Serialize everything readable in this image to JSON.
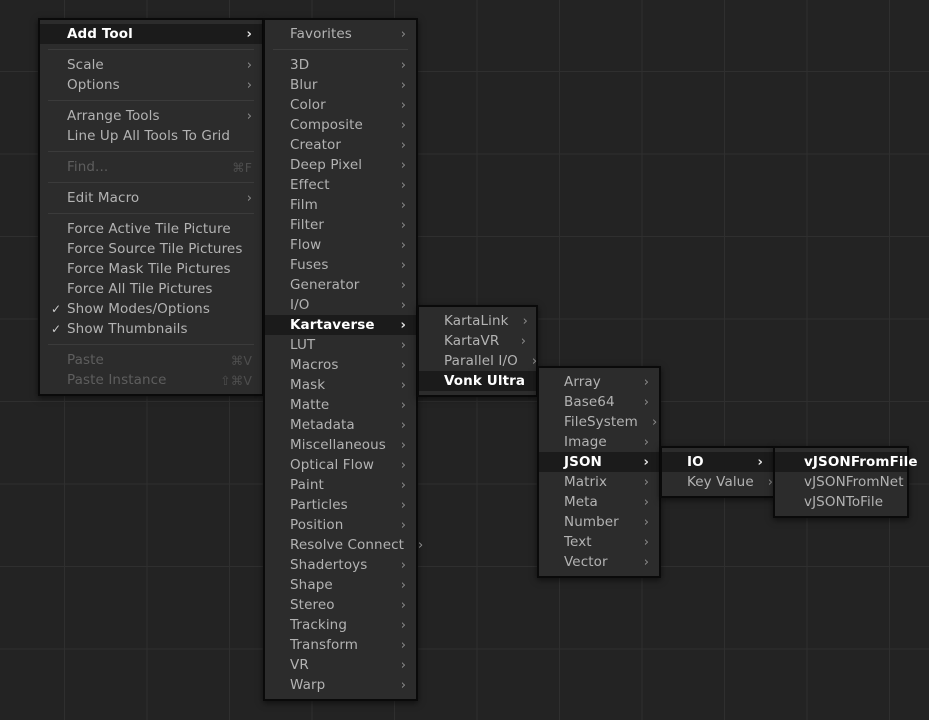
{
  "app": {
    "surface": "fusion-node-editor-canvas",
    "background_color": "#232323",
    "grid_line_color": "#2f2f2f",
    "menu_background": "#2c2c2c",
    "menu_border": "#0a0a0a",
    "menu_text": "#b3b3b3",
    "menu_text_disabled": "#5e5e5e",
    "highlight_background": "#1b1b1b",
    "highlight_text": "#ffffff"
  },
  "icons": {
    "submenu_arrow": "›",
    "checkmark": "✓"
  },
  "menus": {
    "main": {
      "name": "node-editor-context-menu",
      "items": [
        {
          "label": "Add Tool",
          "arrow": true,
          "highlighted": true
        },
        {
          "separator": true
        },
        {
          "label": "Scale",
          "arrow": true
        },
        {
          "label": "Options",
          "arrow": true
        },
        {
          "separator": true
        },
        {
          "label": "Arrange Tools",
          "arrow": true
        },
        {
          "label": "Line Up All Tools To Grid"
        },
        {
          "separator": true
        },
        {
          "label": "Find...",
          "shortcut": "⌘F",
          "disabled": true
        },
        {
          "separator": true
        },
        {
          "label": "Edit Macro",
          "arrow": true
        },
        {
          "separator": true
        },
        {
          "label": "Force Active Tile Picture"
        },
        {
          "label": "Force Source Tile Pictures"
        },
        {
          "label": "Force Mask Tile Pictures"
        },
        {
          "label": "Force All Tile Pictures"
        },
        {
          "label": "Show Modes/Options",
          "checked": true
        },
        {
          "label": "Show Thumbnails",
          "checked": true
        },
        {
          "separator": true
        },
        {
          "label": "Paste",
          "shortcut": "⌘V",
          "disabled": true
        },
        {
          "label": "Paste Instance",
          "shortcut": "⇧⌘V",
          "disabled": true
        }
      ]
    },
    "categories": {
      "name": "add-tool-category-menu",
      "items": [
        {
          "label": "Favorites",
          "arrow": true
        },
        {
          "separator": true
        },
        {
          "label": "3D",
          "arrow": true
        },
        {
          "label": "Blur",
          "arrow": true
        },
        {
          "label": "Color",
          "arrow": true
        },
        {
          "label": "Composite",
          "arrow": true
        },
        {
          "label": "Creator",
          "arrow": true
        },
        {
          "label": "Deep Pixel",
          "arrow": true
        },
        {
          "label": "Effect",
          "arrow": true
        },
        {
          "label": "Film",
          "arrow": true
        },
        {
          "label": "Filter",
          "arrow": true
        },
        {
          "label": "Flow",
          "arrow": true
        },
        {
          "label": "Fuses",
          "arrow": true
        },
        {
          "label": "Generator",
          "arrow": true
        },
        {
          "label": "I/O",
          "arrow": true
        },
        {
          "label": "Kartaverse",
          "arrow": true,
          "highlighted": true
        },
        {
          "label": "LUT",
          "arrow": true
        },
        {
          "label": "Macros",
          "arrow": true
        },
        {
          "label": "Mask",
          "arrow": true
        },
        {
          "label": "Matte",
          "arrow": true
        },
        {
          "label": "Metadata",
          "arrow": true
        },
        {
          "label": "Miscellaneous",
          "arrow": true
        },
        {
          "label": "Optical Flow",
          "arrow": true
        },
        {
          "label": "Paint",
          "arrow": true
        },
        {
          "label": "Particles",
          "arrow": true
        },
        {
          "label": "Position",
          "arrow": true
        },
        {
          "label": "Resolve Connect",
          "arrow": true
        },
        {
          "label": "Shadertoys",
          "arrow": true
        },
        {
          "label": "Shape",
          "arrow": true
        },
        {
          "label": "Stereo",
          "arrow": true
        },
        {
          "label": "Tracking",
          "arrow": true
        },
        {
          "label": "Transform",
          "arrow": true
        },
        {
          "label": "VR",
          "arrow": true
        },
        {
          "label": "Warp",
          "arrow": true
        }
      ]
    },
    "kartaverse": {
      "name": "kartaverse-submenu",
      "items": [
        {
          "label": "KartaLink",
          "arrow": true
        },
        {
          "label": "KartaVR",
          "arrow": true
        },
        {
          "label": "Parallel I/O",
          "arrow": true
        },
        {
          "label": "Vonk Ultra",
          "arrow": true,
          "highlighted": true
        }
      ]
    },
    "vonk_ultra": {
      "name": "vonk-ultra-submenu",
      "items": [
        {
          "label": "Array",
          "arrow": true
        },
        {
          "label": "Base64",
          "arrow": true
        },
        {
          "label": "FileSystem",
          "arrow": true
        },
        {
          "label": "Image",
          "arrow": true
        },
        {
          "label": "JSON",
          "arrow": true,
          "highlighted": true
        },
        {
          "label": "Matrix",
          "arrow": true
        },
        {
          "label": "Meta",
          "arrow": true
        },
        {
          "label": "Number",
          "arrow": true
        },
        {
          "label": "Text",
          "arrow": true
        },
        {
          "label": "Vector",
          "arrow": true
        }
      ]
    },
    "json": {
      "name": "json-submenu",
      "items": [
        {
          "label": "IO",
          "arrow": true,
          "highlighted": true
        },
        {
          "label": "Key Value",
          "arrow": true
        }
      ]
    },
    "io": {
      "name": "json-io-submenu",
      "items": [
        {
          "label": "vJSONFromFile",
          "highlighted": true
        },
        {
          "label": "vJSONFromNet"
        },
        {
          "label": "vJSONToFile"
        }
      ]
    }
  }
}
